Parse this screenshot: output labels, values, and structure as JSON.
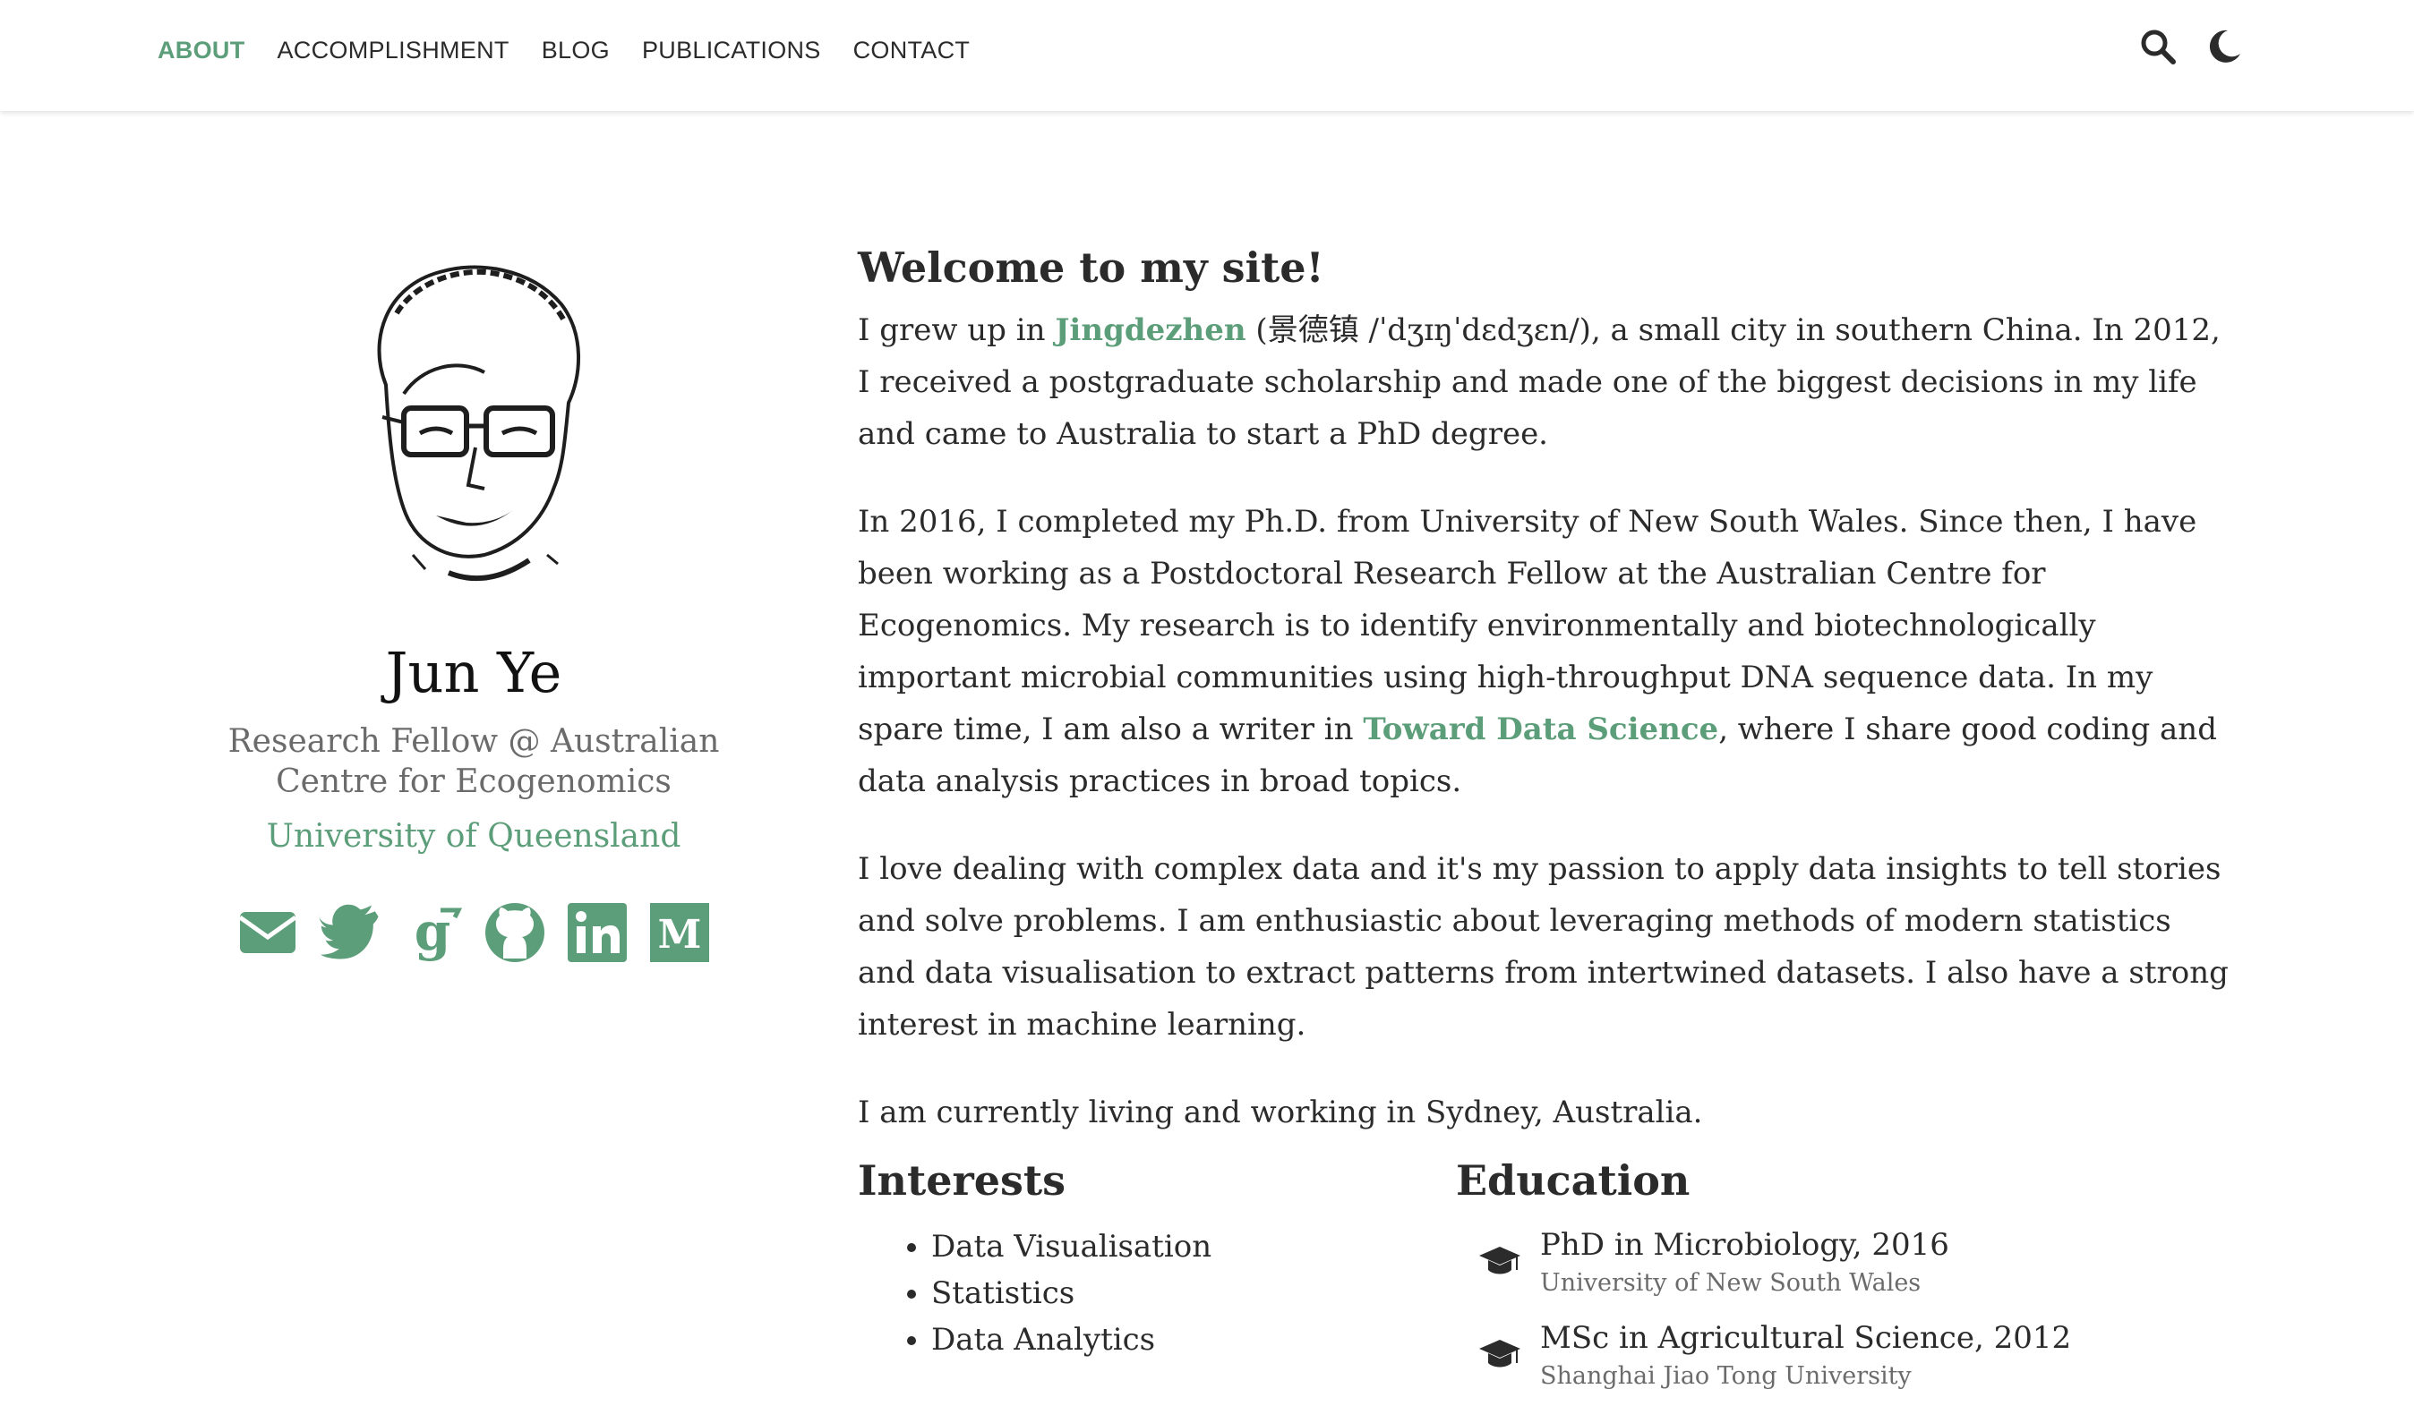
{
  "nav": {
    "items": [
      {
        "label": "ABOUT",
        "active": true
      },
      {
        "label": "ACCOMPLISHMENT"
      },
      {
        "label": "BLOG"
      },
      {
        "label": "PUBLICATIONS"
      },
      {
        "label": "CONTACT"
      }
    ],
    "tools": [
      "search-icon",
      "moon-icon"
    ]
  },
  "profile": {
    "name": "Jun Ye",
    "role": "Research Fellow @ Australian Centre for Ecogenomics",
    "org": "University of Queensland",
    "social": [
      "email-icon",
      "twitter-icon",
      "google-scholar-icon",
      "github-icon",
      "linkedin-icon",
      "medium-icon"
    ]
  },
  "main": {
    "heading": "Welcome to my site!",
    "p1": {
      "before": "I grew up in ",
      "link": "Jingdezhen",
      "after": " (景德镇 /ˈdʒɪŋˈdɛdʒɛn/), a small city in southern China. In 2012, I received a postgraduate scholarship and made one of the biggest decisions in my life and came to Australia to start a PhD degree."
    },
    "p2": {
      "before": "In 2016, I completed my Ph.D. from University of New South Wales. Since then, I have been working as a Postdoctoral Research Fellow at the Australian Centre for Ecogenomics. My research is to identify environmentally and biotechnologically important microbial communities using high-throughput DNA sequence data. In my spare time, I am also a writer in ",
      "link": "Toward Data Science",
      "after": ", where I share good coding and data analysis practices in broad topics."
    },
    "p3": "I love dealing with complex data and it's my passion to apply data insights to tell stories and solve problems. I am enthusiastic about leveraging methods of modern statistics and data visualisation to extract patterns from intertwined datasets. I also have a strong interest in machine learning.",
    "p4": "I am currently living and working in Sydney, Australia.",
    "interests": {
      "title": "Interests",
      "items": [
        "Data Visualisation",
        "Statistics",
        "Data Analytics"
      ]
    },
    "education": {
      "title": "Education",
      "items": [
        {
          "degree": "PhD in Microbiology, 2016",
          "school": "University of New South Wales"
        },
        {
          "degree": "MSc in Agricultural Science, 2012",
          "school": "Shanghai Jiao Tong University"
        }
      ]
    }
  },
  "colors": {
    "accent": "#5d9e7a",
    "text": "#2b2b2b",
    "muted": "#6b6b6b"
  }
}
